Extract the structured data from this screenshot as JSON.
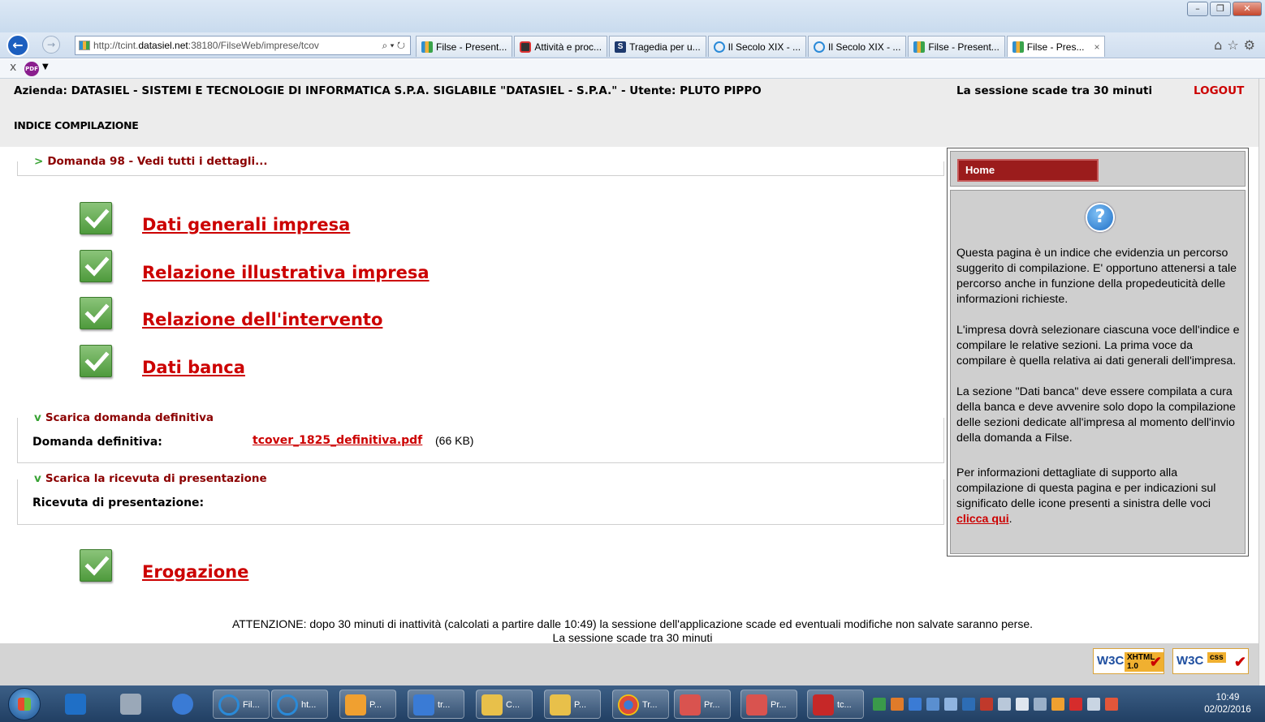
{
  "browser": {
    "url_prefix": "http://tcint.",
    "url_domain": "datasiel.net",
    "url_rest": ":38180/FilseWeb/imprese/tcov",
    "tabs": [
      {
        "label": "Filse - Present...",
        "icon": "filse-icon"
      },
      {
        "label": "Attività e proc...",
        "icon": "app-icon"
      },
      {
        "label": "Tragedia per u...",
        "icon": "s-icon"
      },
      {
        "label": "Il Secolo XIX - ...",
        "icon": "ie-icon"
      },
      {
        "label": "Il Secolo XIX - ...",
        "icon": "ie-icon"
      },
      {
        "label": "Filse - Present...",
        "icon": "filse-icon"
      },
      {
        "label": "Filse - Pres...",
        "icon": "filse-icon"
      }
    ],
    "tab_close": "×",
    "cmd_close": "x"
  },
  "header": {
    "company_line": "Azienda: DATASIEL - SISTEMI E TECNOLOGIE DI INFORMATICA S.P.A. SIGLABILE \"DATASIEL - S.P.A.\" - Utente: PLUTO PIPPO",
    "session_text": "La sessione scade tra 30 minuti",
    "logout": "LOGOUT",
    "index_title": "INDICE COMPILAZIONE"
  },
  "domanda": {
    "legend": "Domanda 98 - Vedi tutti i dettagli..."
  },
  "index_items": [
    {
      "label": "Dati generali impresa",
      "status": "complete"
    },
    {
      "label": "Relazione illustrativa impresa",
      "status": "complete"
    },
    {
      "label": "Relazione dell'intervento",
      "status": "complete"
    },
    {
      "label": "Dati banca",
      "status": "complete"
    }
  ],
  "download_final": {
    "legend": "Scarica domanda definitiva",
    "label": "Domanda definitiva:",
    "file": "tcover_1825_definitiva.pdf",
    "size": "(66 KB)"
  },
  "download_receipt": {
    "legend": "Scarica la ricevuta di presentazione",
    "label": "Ricevuta di presentazione:"
  },
  "erogazione": {
    "label": "Erogazione",
    "status": "complete"
  },
  "help": {
    "home": "Home",
    "icon": "?",
    "p1": "Questa pagina è un indice che evidenzia un percorso suggerito di compilazione. E' opportuno attenersi a tale percorso anche in funzione della propedeuticità delle informazioni richieste.",
    "p2a": "L'impresa dovrà selezionare ciascuna voce dell'indice e compilare le relative sezioni. La prima voce da compilare è quella relativa ai dati generali dell'impresa.",
    "p2b": "La sezione \"Dati banca\" deve essere compilata a cura della banca e deve avvenire solo dopo la compilazione delle sezioni dedicate all'impresa al momento dell'invio della domanda a Filse.",
    "p3": "Per informazioni dettagliate di supporto alla compilazione di questa pagina e per indicazioni sul significato delle icone presenti a sinistra delle voci",
    "p3_link": "clicca qui",
    "p3_end": "."
  },
  "footer": {
    "attention": "ATTENZIONE: dopo 30 minuti di inattività (calcolati a partire dalle 10:49) la sessione dell'applicazione scade ed eventuali modifiche non salvate saranno perse.",
    "session": "La sessione scade tra 30 minuti",
    "badge_xhtml": {
      "w3c": "W3C",
      "tag": "XHTML 1.0"
    },
    "badge_css": {
      "w3c": "W3C",
      "tag": "css"
    }
  },
  "taskbar": {
    "windows": [
      {
        "label": "Fil...",
        "color": "#2a8ad8"
      },
      {
        "label": "ht...",
        "color": "#2a8ad8"
      },
      {
        "label": "P...",
        "color": "#f0a030"
      },
      {
        "label": "tr...",
        "color": "#3a7bd5"
      },
      {
        "label": "C...",
        "color": "#e8c04a"
      },
      {
        "label": "P...",
        "color": "#e8c04a"
      },
      {
        "label": "Tr...",
        "color": "#dd4b39"
      },
      {
        "label": "Pr...",
        "color": "#d9534f"
      },
      {
        "label": "Pr...",
        "color": "#d9534f"
      },
      {
        "label": "tc...",
        "color": "#c62828"
      }
    ],
    "time": "10:49",
    "date": "02/02/2016"
  }
}
